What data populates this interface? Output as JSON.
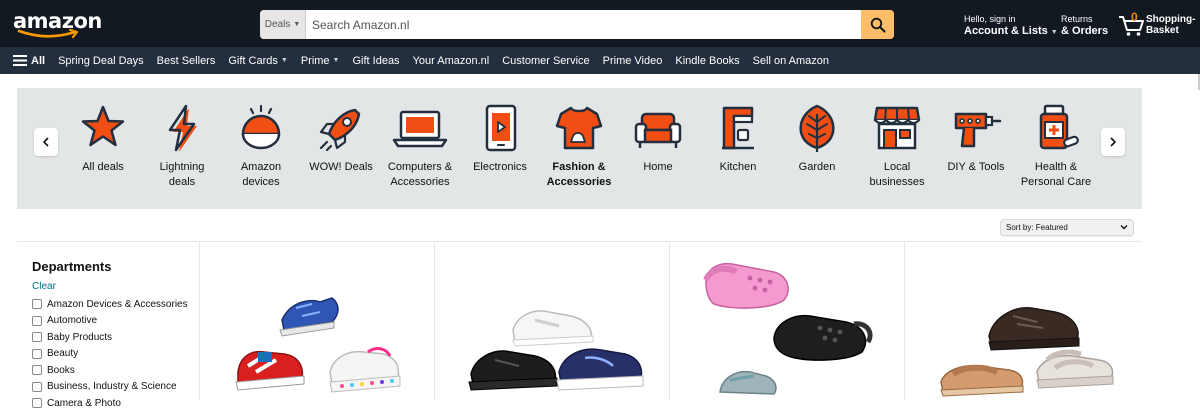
{
  "header": {
    "logo_text": "amazon",
    "search": {
      "category": "Deals",
      "placeholder": "Search Amazon.nl"
    },
    "account": {
      "line1": "Hello, sign in",
      "line2": "Account & Lists"
    },
    "returns": {
      "line1": "Returns",
      "line2": "& Orders"
    },
    "cart": {
      "count": "0",
      "line1": "Shopping-",
      "line2": "Basket"
    }
  },
  "nav": {
    "all_label": "All",
    "items": [
      {
        "label": "Spring Deal Days",
        "dropdown": false
      },
      {
        "label": "Best Sellers",
        "dropdown": false
      },
      {
        "label": "Gift Cards",
        "dropdown": true
      },
      {
        "label": "Prime",
        "dropdown": true
      },
      {
        "label": "Gift Ideas",
        "dropdown": false
      },
      {
        "label": "Your Amazon.nl",
        "dropdown": false
      },
      {
        "label": "Customer Service",
        "dropdown": false
      },
      {
        "label": "Prime Video",
        "dropdown": false
      },
      {
        "label": "Kindle Books",
        "dropdown": false
      },
      {
        "label": "Sell on Amazon",
        "dropdown": false
      }
    ]
  },
  "categories": [
    {
      "icon": "star-icon",
      "line1": "All deals",
      "line2": "",
      "bold": false
    },
    {
      "icon": "lightning-icon",
      "line1": "Lightning",
      "line2": "deals",
      "bold": false
    },
    {
      "icon": "smart-speaker-icon",
      "line1": "Amazon",
      "line2": "devices",
      "bold": false
    },
    {
      "icon": "rocket-icon",
      "line1": "WOW! Deals",
      "line2": "",
      "bold": false
    },
    {
      "icon": "laptop-icon",
      "line1": "Computers &",
      "line2": "Accessories",
      "bold": false
    },
    {
      "icon": "tablet-icon",
      "line1": "Electronics",
      "line2": "",
      "bold": false
    },
    {
      "icon": "tshirt-icon",
      "line1": "Fashion &",
      "line2": "Accessories",
      "bold": true
    },
    {
      "icon": "sofa-icon",
      "line1": "Home",
      "line2": "",
      "bold": false
    },
    {
      "icon": "coffee-machine-icon",
      "line1": "Kitchen",
      "line2": "",
      "bold": false
    },
    {
      "icon": "leaf-icon",
      "line1": "Garden",
      "line2": "",
      "bold": false
    },
    {
      "icon": "storefront-icon",
      "line1": "Local",
      "line2": "businesses",
      "bold": false
    },
    {
      "icon": "drill-icon",
      "line1": "DIY & Tools",
      "line2": "",
      "bold": false
    },
    {
      "icon": "medicine-bottle-icon",
      "line1": "Health &",
      "line2": "Personal Care",
      "bold": false
    }
  ],
  "sort": {
    "label": "Sort by: Featured"
  },
  "sidebar": {
    "title": "Departments",
    "clear": "Clear",
    "departments": [
      "Amazon Devices & Accessories",
      "Automotive",
      "Baby Products",
      "Beauty",
      "Books",
      "Business, Industry & Science",
      "Camera & Photo"
    ]
  },
  "products": [
    {
      "image": "kids-sneakers-sandals-image"
    },
    {
      "image": "sneakers-white-black-navy-image"
    },
    {
      "image": "clogs-pink-black-image"
    },
    {
      "image": "walking-shoes-sandals-image"
    }
  ],
  "colors": {
    "header_bg": "#131921",
    "nav_bg": "#232f3e",
    "search_button": "#febd69",
    "icon_orange": "#f04e12",
    "icon_dark": "#232f3e",
    "link": "#007185",
    "strip_bg": "#e3e6e6"
  }
}
